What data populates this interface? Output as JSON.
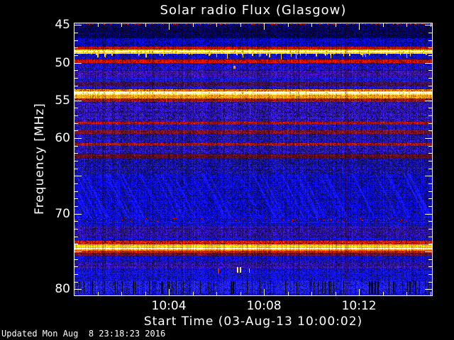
{
  "figure": {
    "title": "Solar radio Flux (Glasgow)",
    "updated": "Updated Mon Aug  8 23:18:23 2016"
  },
  "chart_data": {
    "type": "heatmap",
    "title": "Solar radio Flux (Glasgow)",
    "xlabel": "Start Time (03-Aug-13 10:00:02)",
    "ylabel": "Frequency [MHz]",
    "x_unit": "minutes after 10:00:02 UT",
    "xlim_min": [
      0,
      15.1
    ],
    "ylim_mhz": [
      44.7,
      80.9
    ],
    "y_inverted": true,
    "grid": false,
    "x_major_ticks": [
      {
        "t_min": 4,
        "label": "10:04"
      },
      {
        "t_min": 8,
        "label": "10:08"
      },
      {
        "t_min": 12,
        "label": "10:12"
      }
    ],
    "x_minor_step_min": 1,
    "y_labeled_ticks": [
      45,
      50,
      55,
      60,
      70,
      80
    ],
    "y_major_step_mhz": 5,
    "y_minor_step_mhz": 1,
    "background_color": "#1212cc",
    "bands": [
      {
        "f0": 44.7,
        "f1": 45.0,
        "color": "#0a06a8",
        "noise": 0.5,
        "speckle": "#cc1414",
        "speckle_density": 0.3
      },
      {
        "f0": 45.0,
        "f1": 46.79,
        "color": "#05054e",
        "noise": 0.7
      },
      {
        "f0": 46.79,
        "f1": 47.92,
        "color": "#0a0abe",
        "noise": 0.55
      },
      {
        "f0": 47.92,
        "f1": 48.29,
        "color": "#c41200",
        "noise": 0.45
      },
      {
        "f0": 48.29,
        "f1": 48.86,
        "color": "#ffd414",
        "noise": 0.22,
        "core": "#fff4b4"
      },
      {
        "f0": 48.86,
        "f1": 49.61,
        "color": "#1010c8",
        "noise": 0.5
      },
      {
        "f0": 49.61,
        "f1": 50.08,
        "color": "#c01000",
        "noise": 0.5
      },
      {
        "f0": 50.08,
        "f1": 51.11,
        "color": "#1a12ae",
        "noise": 0.55
      },
      {
        "f0": 51.11,
        "f1": 52.05,
        "color": "#3612a0",
        "noise": 0.5
      },
      {
        "f0": 52.05,
        "f1": 52.62,
        "color": "#1616c8",
        "noise": 0.5
      },
      {
        "f0": 52.62,
        "f1": 53.18,
        "color": "#44104e",
        "noise": 0.55
      },
      {
        "f0": 53.18,
        "f1": 53.56,
        "color": "#1f12b4",
        "noise": 0.5
      },
      {
        "f0": 53.56,
        "f1": 53.84,
        "color": "#e06400",
        "noise": 0.5,
        "speckle": "#ffd700",
        "speckle_density": 0.15
      },
      {
        "f0": 53.84,
        "f1": 54.22,
        "color": "#ffe070",
        "noise": 0.15,
        "core": "#ffffff"
      },
      {
        "f0": 54.22,
        "f1": 54.69,
        "color": "#fa9212",
        "noise": 0.35
      },
      {
        "f0": 54.69,
        "f1": 55.16,
        "color": "#a01616",
        "noise": 0.5
      },
      {
        "f0": 55.16,
        "f1": 57.79,
        "color": "#2a14a4",
        "noise": 0.6
      },
      {
        "f0": 57.79,
        "f1": 58.17,
        "color": "#aa1212",
        "noise": 0.5
      },
      {
        "f0": 58.17,
        "f1": 58.83,
        "color": "#2014b0",
        "noise": 0.55
      },
      {
        "f0": 58.83,
        "f1": 59.39,
        "color": "#6e1022",
        "noise": 0.5
      },
      {
        "f0": 59.39,
        "f1": 60.61,
        "color": "#2013a8",
        "noise": 0.6
      },
      {
        "f0": 60.61,
        "f1": 60.99,
        "color": "#8c1414",
        "noise": 0.5
      },
      {
        "f0": 60.99,
        "f1": 62.02,
        "color": "#2413a2",
        "noise": 0.6
      },
      {
        "f0": 62.02,
        "f1": 62.59,
        "color": "#5a0e20",
        "noise": 0.5
      },
      {
        "f0": 62.59,
        "f1": 64.66,
        "color": "#17129e",
        "noise": 0.6
      },
      {
        "f0": 64.66,
        "f1": 70.49,
        "color": "#0d0dbc",
        "noise": 0.55,
        "texture": "diag"
      },
      {
        "f0": 70.49,
        "f1": 71.05,
        "color": "#100fc2",
        "noise": 0.5,
        "speckle": "#c82000",
        "speckle_density": 0.05
      },
      {
        "f0": 71.05,
        "f1": 71.71,
        "color": "#1212c8",
        "noise": 0.5
      },
      {
        "f0": 71.71,
        "f1": 73.22,
        "color": "#2a119c",
        "noise": 0.55
      },
      {
        "f0": 73.22,
        "f1": 73.59,
        "color": "#1414cc",
        "noise": 0.5
      },
      {
        "f0": 73.59,
        "f1": 74.06,
        "color": "#b41400",
        "noise": 0.55,
        "speckle": "#ff4400",
        "speckle_density": 0.2
      },
      {
        "f0": 74.06,
        "f1": 74.53,
        "color": "#ffd012",
        "noise": 0.18
      },
      {
        "f0": 74.53,
        "f1": 74.72,
        "color": "#fffbe0",
        "noise": 0.08
      },
      {
        "f0": 74.72,
        "f1": 74.91,
        "color": "#ff9010",
        "noise": 0.3
      },
      {
        "f0": 74.91,
        "f1": 75.19,
        "color": "#c02400",
        "noise": 0.4
      },
      {
        "f0": 75.19,
        "f1": 75.57,
        "color": "#5e1038",
        "noise": 0.5
      },
      {
        "f0": 75.57,
        "f1": 76.41,
        "color": "#1111cc",
        "noise": 0.5
      },
      {
        "f0": 76.41,
        "f1": 77.26,
        "color": "#2a129e",
        "noise": 0.55
      },
      {
        "f0": 77.26,
        "f1": 78.95,
        "color": "#1212cc",
        "noise": 0.5
      },
      {
        "f0": 78.95,
        "f1": 80.65,
        "color": "#1c1ce6",
        "noise": 0.6,
        "texture": "vstreak"
      },
      {
        "f0": 80.65,
        "f1": 80.9,
        "color": "#1212b0",
        "noise": 0.5
      }
    ],
    "rfi_spike_line": {
      "f_base_mhz": 48.86,
      "count": 70,
      "max_len_mhz": 0.8,
      "color": "#ffd700"
    },
    "events": [
      {
        "t_min": 6.72,
        "f_mhz": 50.64,
        "w": 3,
        "h": 4,
        "color": "#ff9900"
      },
      {
        "t_min": 6.06,
        "f_mhz": 77.55,
        "w": 2,
        "h": 7,
        "color": "#dd2200"
      },
      {
        "t_min": 6.85,
        "f_mhz": 77.45,
        "w": 2,
        "h": 8,
        "color": "#ffee66"
      },
      {
        "t_min": 6.97,
        "f_mhz": 77.45,
        "w": 2,
        "h": 8,
        "color": "#ffe066"
      },
      {
        "t_min": 7.37,
        "f_mhz": 77.55,
        "w": 1,
        "h": 6,
        "color": "#ffe066"
      }
    ],
    "vertical_feature": {
      "t_min": 11.46,
      "color": "rgba(140,0,20,0.22)"
    },
    "axis_color": "#ffffff"
  }
}
